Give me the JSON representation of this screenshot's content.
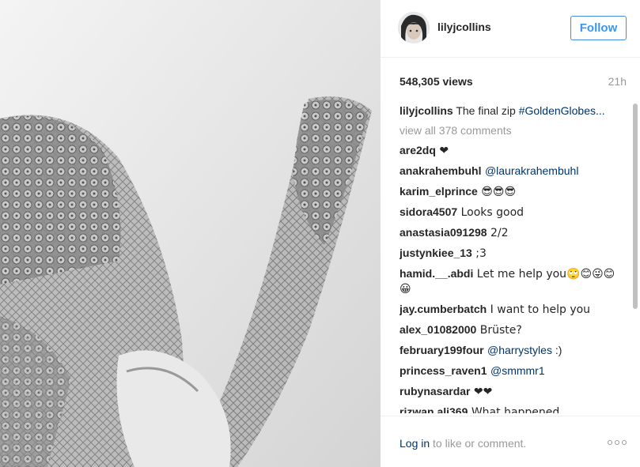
{
  "post": {
    "username": "lilyjcollins",
    "follow_label": "Follow",
    "views": "548,305 views",
    "time": "21h",
    "caption_user": "lilyjcollins",
    "caption_text": "The final zip ",
    "caption_tag": "#GoldenGlobes...",
    "view_all": "view all 378 comments"
  },
  "comments": [
    {
      "user": "are2dq",
      "text": " ❤"
    },
    {
      "user": "anakrahembuhl",
      "text": " ",
      "mention": "@laurakrahembuhl"
    },
    {
      "user": "karim_elprince",
      "text": " 😎😎😎"
    },
    {
      "user": "sidora4507",
      "text": " Looks good"
    },
    {
      "user": "anastasia091298",
      "text": " 2/2"
    },
    {
      "user": "justynkiee_13",
      "text": " ;3"
    },
    {
      "user": "hamid.__.abdi",
      "text": " Let me help you🙄😊😜😊😀"
    },
    {
      "user": "jay.cumberbatch",
      "text": " I want to help you"
    },
    {
      "user": "alex_01082000",
      "text": " Brüste?"
    },
    {
      "user": "february199four",
      "text": " ",
      "mention": "@harrystyles",
      "suffix": " :)"
    },
    {
      "user": "princess_raven1",
      "text": " ",
      "mention": "@smmmr1"
    },
    {
      "user": "rubynasardar",
      "text": " ❤❤"
    },
    {
      "user": "rizwan.ali369",
      "text": " What happened"
    }
  ],
  "footer": {
    "login_link": "Log in",
    "login_rest": " to like or comment."
  },
  "icons": {
    "more": "more-options-icon",
    "avatar": "profile-avatar"
  },
  "colors": {
    "link": "#003569",
    "follow": "#3897f0",
    "muted": "#999999"
  }
}
